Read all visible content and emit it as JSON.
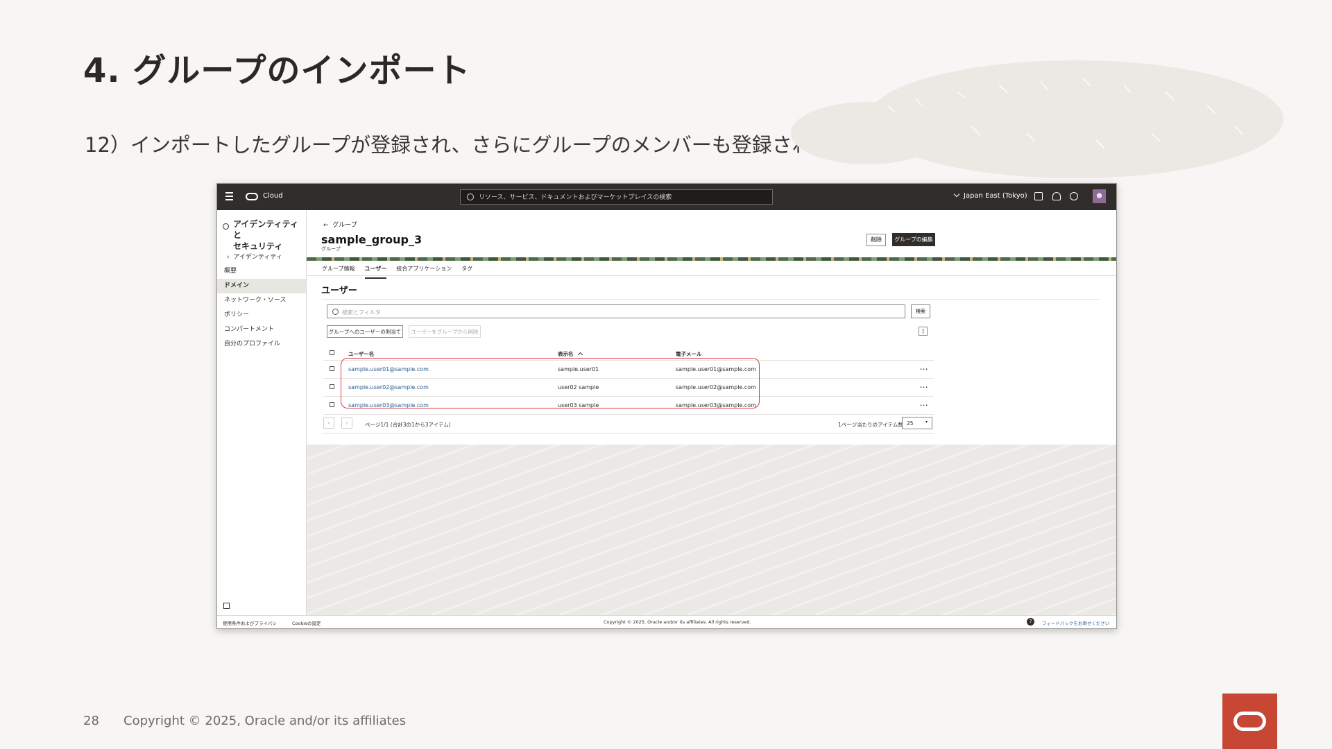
{
  "slide": {
    "title": "4. グループのインポート",
    "subtitle": "12）インポートしたグループが登録され、さらにグループのメンバーも登録されている事を確認します。",
    "page_number": "28",
    "copyright": "Copyright © 2025, Oracle and/or its affiliates"
  },
  "console": {
    "topbar": {
      "brand": "Cloud",
      "search_placeholder": "リソース、サービス、ドキュメントおよびマーケットプレイスの検索",
      "region": "Japan East (Tokyo)"
    },
    "sidebar": {
      "heading_line1": "アイデンティティと",
      "heading_line2": "セキュリティ",
      "back_label": "アイデンティティ",
      "items": [
        {
          "label": "概要"
        },
        {
          "label": "ドメイン",
          "active": true
        },
        {
          "label": "ネットワーク・ソース"
        },
        {
          "label": "ポリシー"
        },
        {
          "label": "コンパートメント"
        },
        {
          "label": "自分のプロファイル"
        }
      ]
    },
    "page": {
      "breadcrumb": "グループ",
      "title": "sample_group_3",
      "subtitle": "グループ",
      "delete_label": "削除",
      "edit_label": "グループの編集",
      "tabs": [
        {
          "label": "グループ情報"
        },
        {
          "label": "ユーザー",
          "active": true
        },
        {
          "label": "統合アプリケーション"
        },
        {
          "label": "タグ"
        }
      ],
      "section_title": "ユーザー",
      "filter_placeholder": "検索とフィルタ",
      "search_label": "検索",
      "assign_label": "グループへのユーザーの割当て",
      "remove_label": "ユーザーをグループから削除",
      "table": {
        "headers": {
          "user": "ユーザー名",
          "display": "表示名",
          "email": "電子メール"
        },
        "rows": [
          {
            "user": "sample.user01@sample.com",
            "display": "sample.user01",
            "email": "sample.user01@sample.com"
          },
          {
            "user": "sample.user02@sample.com",
            "display": "user02 sample",
            "email": "sample.user02@sample.com"
          },
          {
            "user": "sample.user03@sample.com",
            "display": "user03 sample",
            "email": "sample.user03@sample.com"
          }
        ],
        "more": "···"
      },
      "pager": {
        "text": "ページ1/1 (合計3の1から3アイテム)",
        "per_page_label": "1ページ当たりのアイテム数",
        "per_page_value": "25"
      }
    },
    "footer": {
      "terms": "使用条件およびプライバシ",
      "cookie": "Cookieの設定",
      "copyright": "Copyright © 2025, Oracle and/or its affiliates. All rights reserved.",
      "feedback": "フィードバックをお寄せください"
    }
  },
  "colors": {
    "oracle_red": "#c74634",
    "highlight_red": "#d43f3f",
    "topbar": "#312d2a",
    "link": "#2b5d8f"
  }
}
